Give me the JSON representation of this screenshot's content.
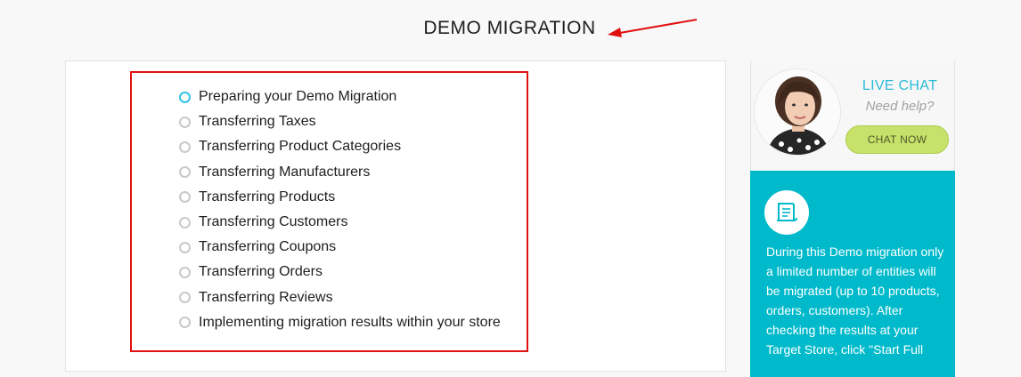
{
  "header": {
    "title": "DEMO MIGRATION"
  },
  "steps": [
    {
      "label": "Preparing your Demo Migration",
      "state": "active"
    },
    {
      "label": "Transferring Taxes",
      "state": "pending"
    },
    {
      "label": "Transferring Product Categories",
      "state": "pending"
    },
    {
      "label": "Transferring Manufacturers",
      "state": "pending"
    },
    {
      "label": "Transferring Products",
      "state": "pending"
    },
    {
      "label": "Transferring Customers",
      "state": "pending"
    },
    {
      "label": "Transferring Coupons",
      "state": "pending"
    },
    {
      "label": "Transferring Orders",
      "state": "pending"
    },
    {
      "label": "Transferring Reviews",
      "state": "pending"
    },
    {
      "label": "Implementing migration results within your store",
      "state": "pending"
    }
  ],
  "chat": {
    "title": "LIVE CHAT",
    "subtitle": "Need help?",
    "button_label": "CHAT NOW"
  },
  "info": {
    "icon": "document-scroll-icon",
    "text": "During this Demo migration only a limited number of entities will be migrated (up to 10 products, orders, customers). After checking the results at your Target Store, click \"Start Full"
  },
  "colors": {
    "accent": "#2bbcd9",
    "info_bg": "#00bacb",
    "chat_button": "#c6e26a",
    "annotation": "#e01010"
  }
}
